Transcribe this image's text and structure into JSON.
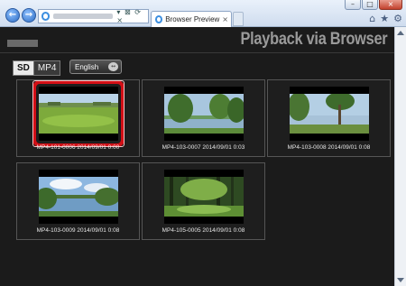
{
  "browser": {
    "tab_title": "Browser Preview",
    "tab_close": "×",
    "address_controls": "▾ ⊠ ⟳ ×",
    "nav": {
      "back": "←",
      "forward": "→"
    },
    "tools": {
      "home": "⌂",
      "favorites": "★",
      "settings": "⚙"
    },
    "window": {
      "minimize": "–",
      "maximize": "□",
      "close": "×"
    }
  },
  "app": {
    "title": "Playback via Browser",
    "media": {
      "sd": "SD",
      "mp4": "MP4"
    },
    "language": "English",
    "language_icon": "↔"
  },
  "clips": [
    {
      "label": "MP4-101-0006 2014/09/01 0:00",
      "selected": true,
      "scene": "golf-course"
    },
    {
      "label": "MP4-103-0007 2014/09/01 0:03",
      "selected": false,
      "scene": "lake-trees"
    },
    {
      "label": "MP4-103-0008 2014/09/01 0:08",
      "selected": false,
      "scene": "lake-tree-wide"
    },
    {
      "label": "MP4-103-0009 2014/09/01 0:08",
      "selected": false,
      "scene": "lake-clouds"
    },
    {
      "label": "MP4-105-0005 2014/09/01 0:08",
      "selected": false,
      "scene": "forest-path"
    }
  ]
}
